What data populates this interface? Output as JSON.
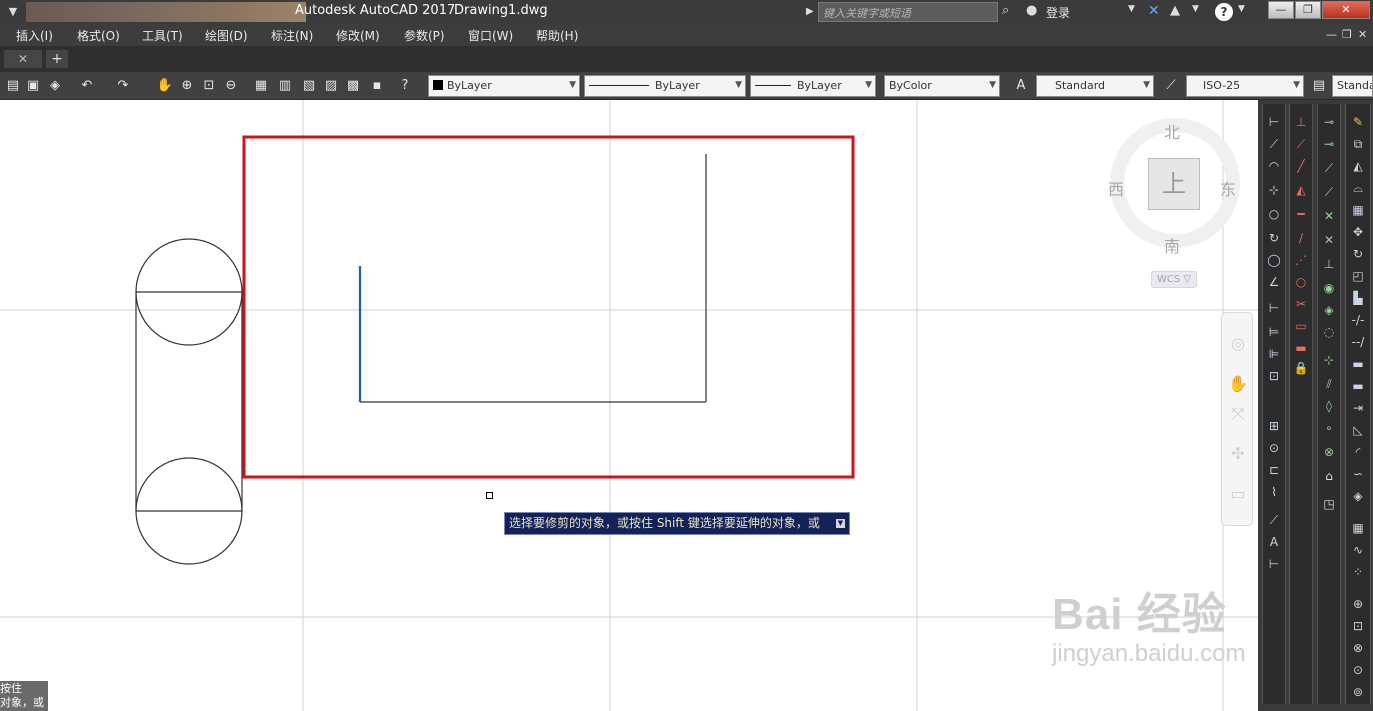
{
  "window": {
    "app_title": "Autodesk AutoCAD 2017",
    "file_name": "Drawing1.dwg",
    "search_placeholder": "键入关键字或短语",
    "login_label": "登录",
    "help_label": "?"
  },
  "menus": [
    "插入(I)",
    "格式(O)",
    "工具(T)",
    "绘图(D)",
    "标注(N)",
    "修改(M)",
    "参数(P)",
    "窗口(W)",
    "帮助(H)"
  ],
  "toolbar": {
    "color": "ByLayer",
    "linetype": "ByLayer",
    "lineweight": "ByLayer",
    "plotstyle": "ByColor",
    "text_style": "Standard",
    "dim_style": "ISO-25",
    "table_style": "Standa"
  },
  "viewcube": {
    "north": "北",
    "south": "南",
    "east": "东",
    "west": "西",
    "face": "上",
    "wcs": "WCS"
  },
  "tooltip": {
    "text": "选择要修剪的对象，或按住 Shift 键选择要延伸的对象，或"
  },
  "command_line": {
    "line1": "按住",
    "line2": "对象，或"
  },
  "watermark": {
    "logo": "Bai 经验",
    "url": "jingyan.baidu.com"
  },
  "colors": {
    "highlight_box": "#d0121b",
    "selected_line": "#1a5fb4",
    "tooltip_bg": "#14225a"
  }
}
